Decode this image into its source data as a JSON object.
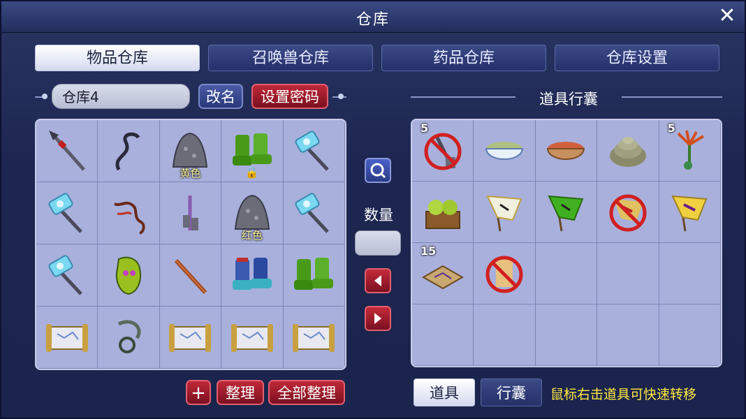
{
  "window": {
    "title": "仓库",
    "close_icon": "✕"
  },
  "tabs": [
    {
      "label": "物品仓库",
      "active": true
    },
    {
      "label": "召唤兽仓库",
      "active": false
    },
    {
      "label": "药品仓库",
      "active": false
    },
    {
      "label": "仓库设置",
      "active": false
    }
  ],
  "warehouse": {
    "name_value": "仓库4",
    "rename_label": "改名",
    "set_password_label": "设置密码",
    "items": [
      {
        "icon": "spear-icon"
      },
      {
        "icon": "whip-icon"
      },
      {
        "icon": "gray-stone-icon",
        "tag": "黄色"
      },
      {
        "icon": "green-boots-icon",
        "locked": true
      },
      {
        "icon": "ice-hammer-icon"
      },
      {
        "icon": "ice-hammer-icon"
      },
      {
        "icon": "vine-icon"
      },
      {
        "icon": "purple-whip-icon"
      },
      {
        "icon": "gray-stone-icon",
        "tag": "红色"
      },
      {
        "icon": "ice-hammer-icon"
      },
      {
        "icon": "ice-hammer-icon"
      },
      {
        "icon": "green-armor-icon"
      },
      {
        "icon": "wooden-staff-icon"
      },
      {
        "icon": "blue-boots-icon"
      },
      {
        "icon": "green-boots-icon"
      },
      {
        "icon": "scroll-icon"
      },
      {
        "icon": "claw-ring-icon"
      },
      {
        "icon": "scroll-icon"
      },
      {
        "icon": "scroll-icon"
      },
      {
        "icon": "scroll-icon"
      }
    ],
    "add_label": "+",
    "sort_label": "整理",
    "sort_all_label": "全部整理"
  },
  "middle": {
    "search_icon": "search-icon",
    "quantity_label": "数量",
    "left_arrow_icon": "arrow-left-icon",
    "right_arrow_icon": "arrow-right-icon"
  },
  "inventory": {
    "title": "道具行囊",
    "items": [
      {
        "icon": "forbidden-shovel-icon",
        "count": "5"
      },
      {
        "icon": "green-soup-bowl-icon"
      },
      {
        "icon": "red-soup-bowl-icon"
      },
      {
        "icon": "shell-icon"
      },
      {
        "icon": "herb-icon",
        "count": "5"
      },
      {
        "icon": "melon-box-icon"
      },
      {
        "icon": "white-flag-icon"
      },
      {
        "icon": "green-flag-icon"
      },
      {
        "icon": "forbidden-flag-icon"
      },
      {
        "icon": "yellow-flag-icon"
      },
      {
        "icon": "treasure-map-icon",
        "count": "15"
      },
      {
        "icon": "forbidden-talisman-icon"
      },
      {
        "icon": ""
      },
      {
        "icon": ""
      },
      {
        "icon": ""
      },
      {
        "icon": ""
      },
      {
        "icon": ""
      },
      {
        "icon": ""
      },
      {
        "icon": ""
      },
      {
        "icon": ""
      }
    ],
    "tab_items_label": "道具",
    "tab_bag_label": "行囊",
    "hint": "鼠标右击道具可快速转移"
  },
  "colors": {
    "accent_red": "#c02838",
    "accent_blue": "#3a4a98",
    "hint_yellow": "#ffe840"
  }
}
